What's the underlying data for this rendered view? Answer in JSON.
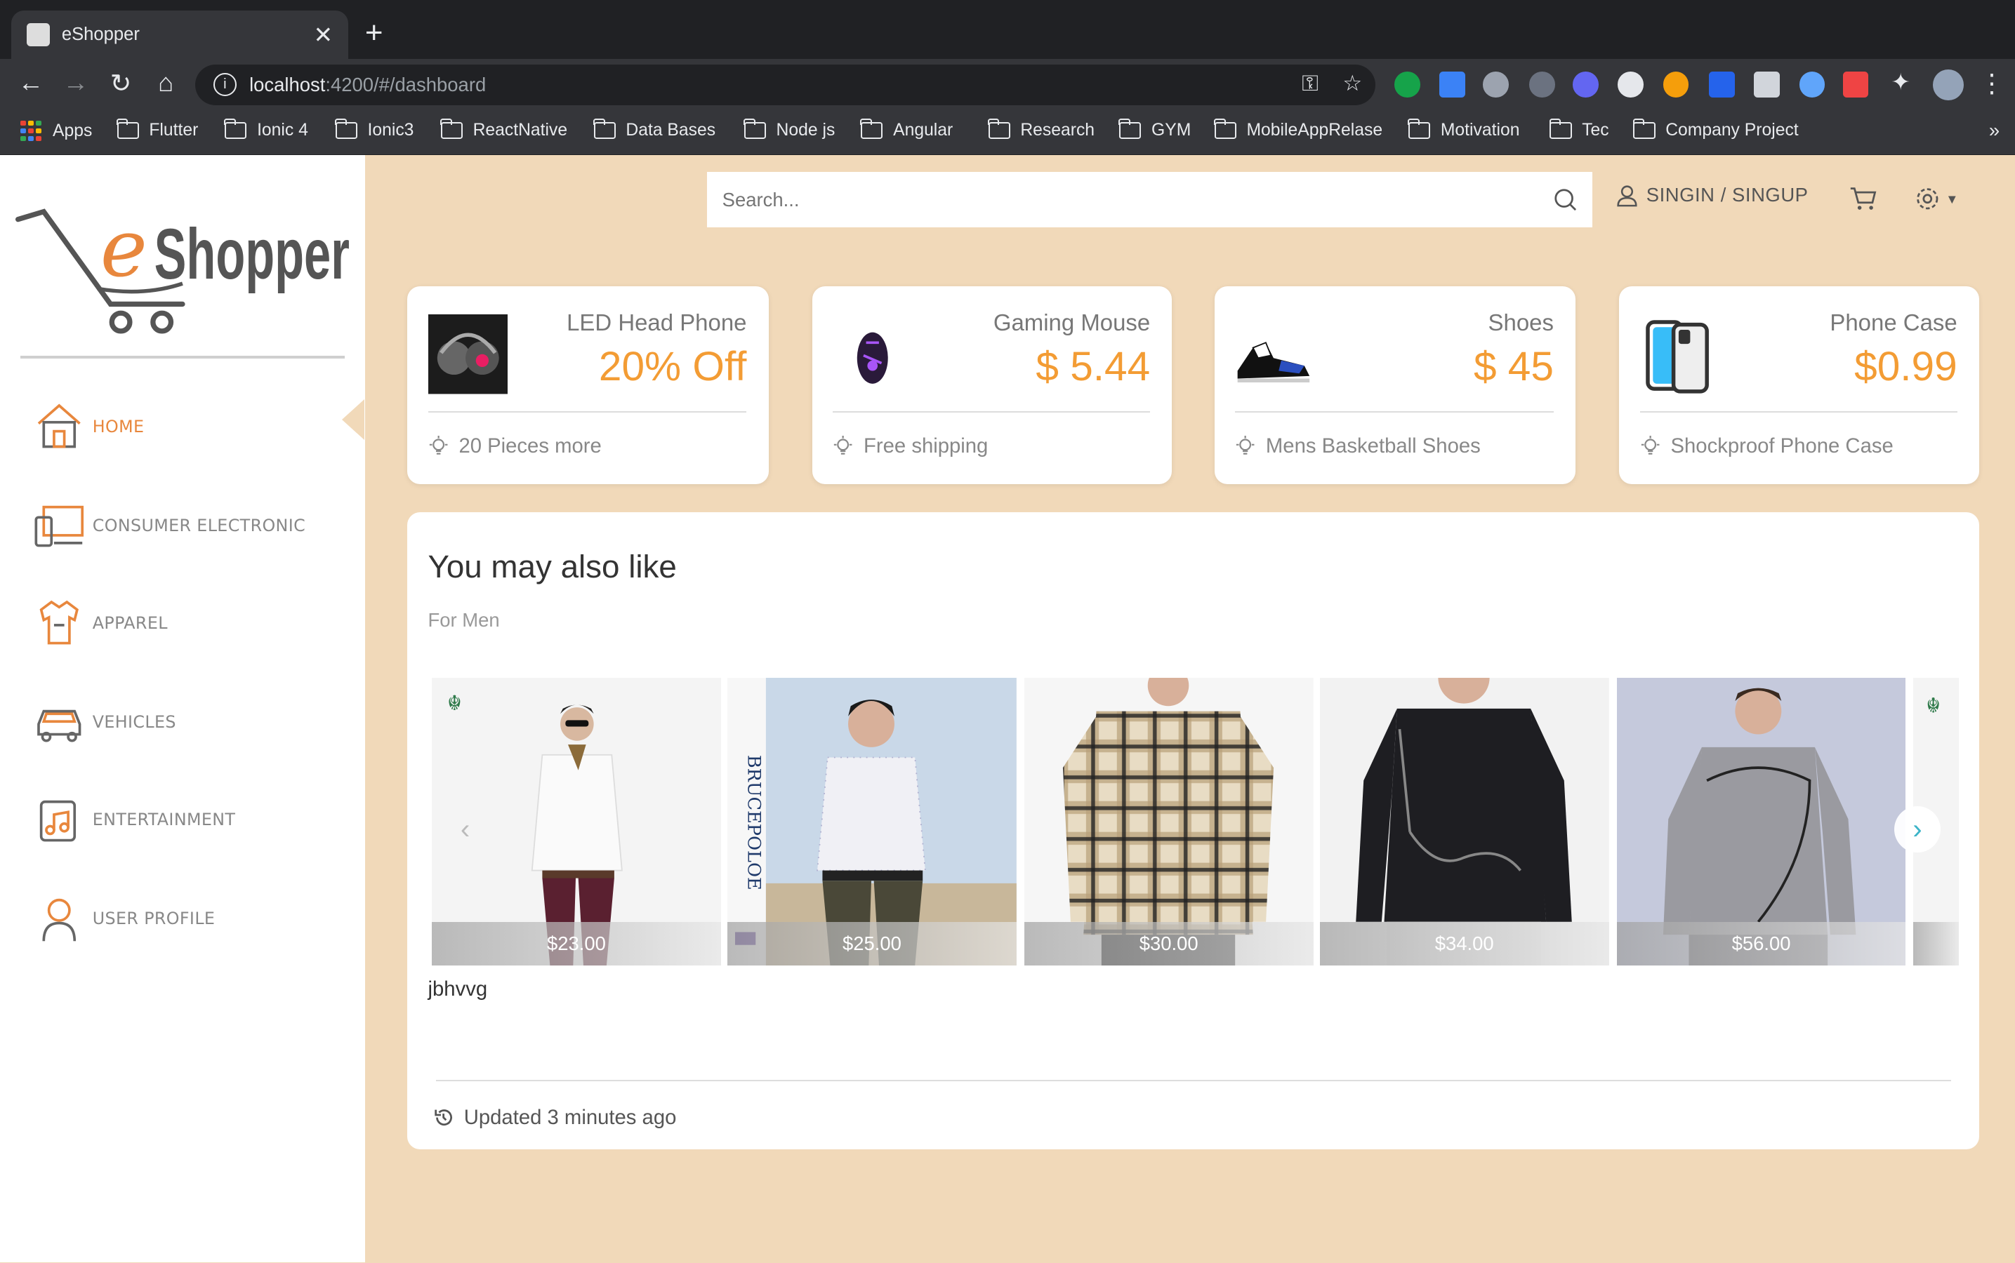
{
  "browser": {
    "tab_title": "eShopper",
    "url_host": "localhost",
    "url_path": ":4200/#/dashboard",
    "bookmarks": [
      "Apps",
      "Flutter",
      "Ionic 4",
      "Ionic3",
      "ReactNative",
      "Data Bases",
      "Node js",
      "Angular",
      "Research",
      "GYM",
      "MobileAppRelase",
      "Motivation",
      "Tec",
      "Company Project"
    ],
    "more": "»"
  },
  "brand": {
    "logo_text_e": "e",
    "logo_text_rest": "Shopper"
  },
  "sidebar": {
    "items": [
      {
        "label": "HOME",
        "icon": "home-icon",
        "active": true
      },
      {
        "label": "CONSUMER ELECTRONIC",
        "icon": "devices-icon",
        "active": false
      },
      {
        "label": "APPAREL",
        "icon": "shirt-icon",
        "active": false
      },
      {
        "label": "VEHICLES",
        "icon": "car-icon",
        "active": false
      },
      {
        "label": "ENTERTAINMENT",
        "icon": "music-icon",
        "active": false
      },
      {
        "label": "USER PROFILE",
        "icon": "user-profile-icon",
        "active": false
      }
    ]
  },
  "header": {
    "search_placeholder": "Search...",
    "signin_label": "SINGIN / SINGUP"
  },
  "promos": [
    {
      "name": "LED Head Phone",
      "price": "20% Off",
      "footer": "20 Pieces more"
    },
    {
      "name": "Gaming Mouse",
      "price": "$ 5.44",
      "footer": "Free shipping"
    },
    {
      "name": "Shoes",
      "price": "$ 45",
      "footer": "Mens Basketball Shoes"
    },
    {
      "name": "Phone Case",
      "price": "$0.99",
      "footer": "Shockproof Phone Case"
    }
  ],
  "recommendations": {
    "title": "You may also like",
    "subtitle": "For Men",
    "products": [
      {
        "price": "$23.00"
      },
      {
        "price": "$25.00",
        "brand": "BRUCEPOLOE"
      },
      {
        "price": "$30.00"
      },
      {
        "price": "$34.00"
      },
      {
        "price": "$56.00"
      }
    ],
    "product_name": "jbhvvg",
    "updated": "Updated 3 minutes ago"
  },
  "colors": {
    "accent": "#e8873d",
    "price": "#f39c34",
    "background": "#f1d9b9"
  }
}
